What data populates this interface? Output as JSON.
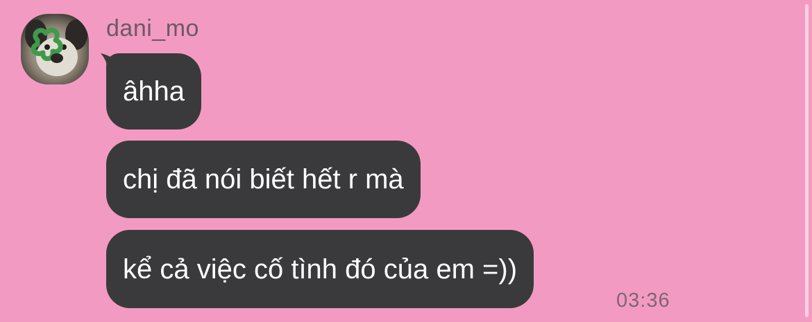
{
  "sender": {
    "name": "dani_mo"
  },
  "messages": [
    {
      "text": "âhha"
    },
    {
      "text": "chị đã nói biết hết r mà"
    },
    {
      "text": "kể cả việc cố tình đó của em =))"
    }
  ],
  "timestamp": "03:36",
  "colors": {
    "background": "#f39ac3",
    "bubble": "#3a3a3c",
    "bubble_text": "#ffffff",
    "muted_text": "#7a6870"
  }
}
